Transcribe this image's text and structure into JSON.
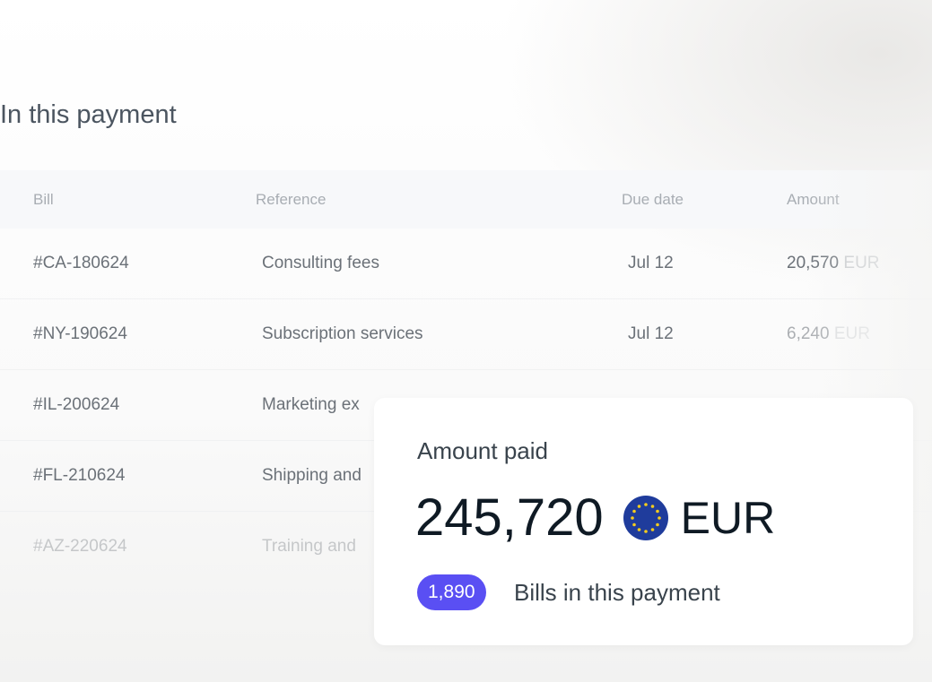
{
  "section_title": "In this payment",
  "table": {
    "headers": {
      "bill": "Bill",
      "reference": "Reference",
      "due_date": "Due date",
      "amount": "Amount"
    },
    "rows": [
      {
        "bill": "#CA-180624",
        "reference": "Consulting fees",
        "due_date": "Jul 12",
        "amount": "20,570",
        "currency": "EUR"
      },
      {
        "bill": "#NY-190624",
        "reference": "Subscription services",
        "due_date": "Jul 12",
        "amount": "6,240",
        "currency": "EUR"
      },
      {
        "bill": "#IL-200624",
        "reference": "Marketing ex"
      },
      {
        "bill": "#FL-210624",
        "reference": "Shipping and"
      },
      {
        "bill": "#AZ-220624",
        "reference": "Training and"
      }
    ]
  },
  "summary_card": {
    "label": "Amount paid",
    "amount": "245,720",
    "currency": "EUR",
    "currency_icon": "eu-flag-icon",
    "bills_count": "1,890",
    "bills_label": "Bills in this payment",
    "badge_color": "#5a4ff3"
  }
}
